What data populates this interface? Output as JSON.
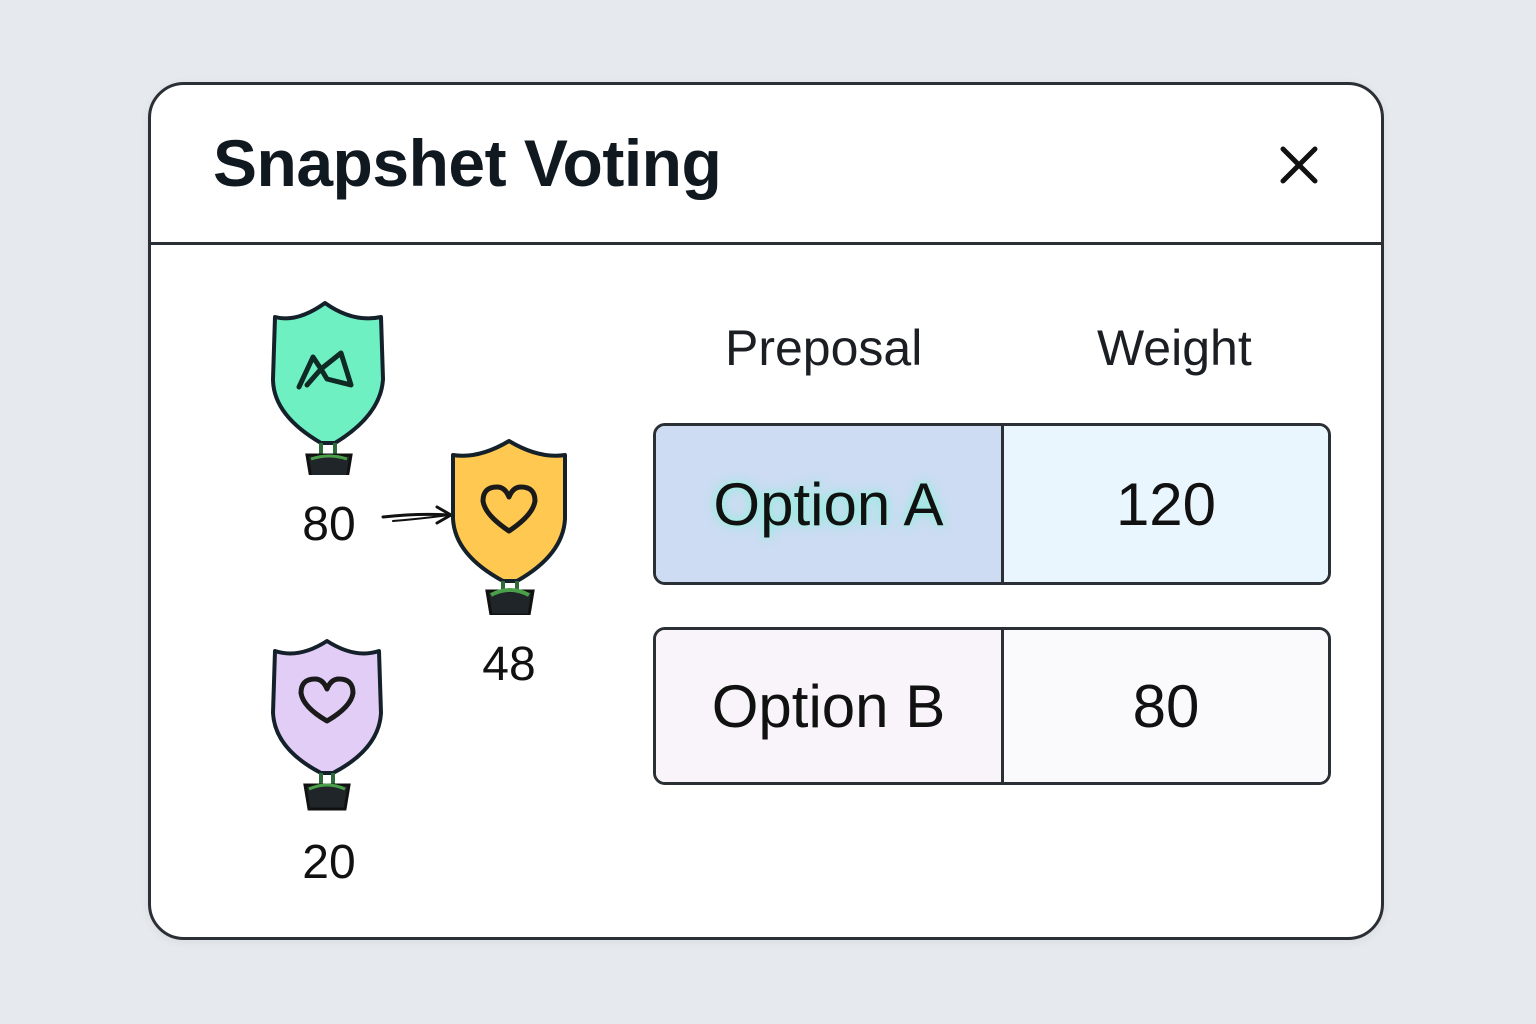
{
  "dialog": {
    "title": "Snapshet Voting",
    "close_icon": "close-icon"
  },
  "voters": [
    {
      "weight": "80",
      "color": "#6ff0c2",
      "icon": "chain-link-icon"
    },
    {
      "weight": "48",
      "color": "#ffc850",
      "icon": "heart-icon"
    },
    {
      "weight": "20",
      "color": "#e2cdf6",
      "icon": "heart-icon"
    }
  ],
  "table": {
    "headers": {
      "proposal": "Preposal",
      "weight": "Weight"
    },
    "rows": [
      {
        "option": "Option A",
        "weight": "120",
        "highlighted": true
      },
      {
        "option": "Option B",
        "weight": "80",
        "highlighted": false
      }
    ]
  },
  "colors": {
    "background": "#e6e9ed",
    "border": "#2b2f36",
    "highlight_row": "#cddcf2",
    "highlight_glow": "#7ff0d8"
  }
}
